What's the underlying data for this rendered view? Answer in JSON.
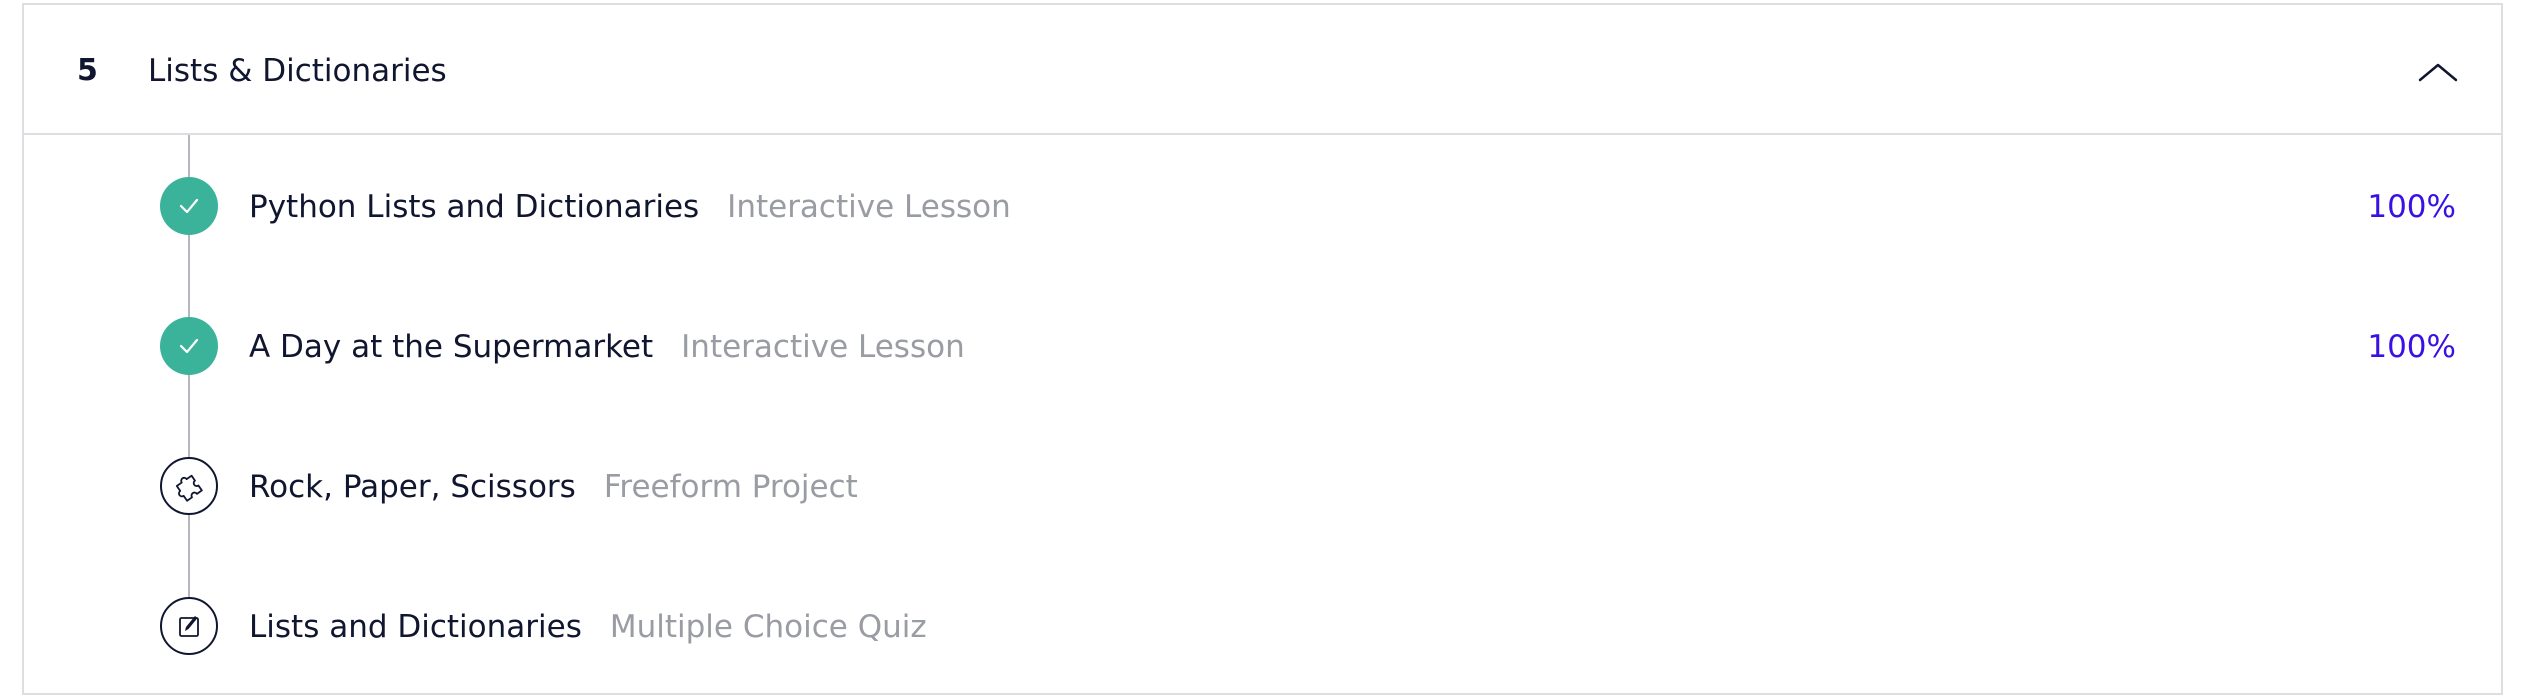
{
  "section": {
    "number": "5",
    "title": "Lists & Dictionaries",
    "collapse_icon": "chevron-up-icon"
  },
  "items": [
    {
      "title": "Python Lists and Dictionaries",
      "type": "Interactive Lesson",
      "progress": "100%",
      "status": "complete",
      "icon": "check-icon"
    },
    {
      "title": "A Day at the Supermarket",
      "type": "Interactive Lesson",
      "progress": "100%",
      "status": "complete",
      "icon": "check-icon"
    },
    {
      "title": "Rock, Paper, Scissors",
      "type": "Freeform Project",
      "progress": "",
      "status": "not-started",
      "icon": "puzzle-icon"
    },
    {
      "title": "Lists and Dictionaries",
      "type": "Multiple Choice Quiz",
      "progress": "",
      "status": "not-started",
      "icon": "quiz-icon"
    }
  ],
  "colors": {
    "complete": "#3bb39b",
    "progress_text": "#3a10e5",
    "muted_text": "#9a9ca3",
    "primary_text": "#10162f",
    "border": "#dcdee2"
  }
}
